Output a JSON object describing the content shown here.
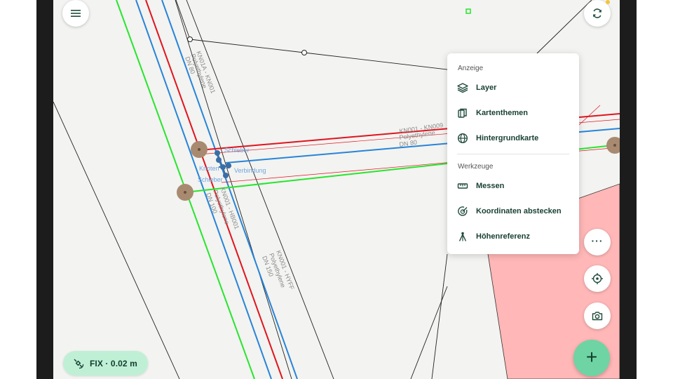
{
  "map": {
    "labels": {
      "kn01a_kn001": "KN01A - KN001",
      "kn01a_material": "Polyethylene",
      "kn01a_dn": "DN 80",
      "kn001_kn009": "KN001 - KN009",
      "kn001_material": "Polyethylene",
      "kn001_dn": "DN 80",
      "kn001_hb001": "KN001 - HB001",
      "kn001_hb001_material": "Polyethylene",
      "kn001_hb001_dn": "DN 100",
      "kn001_hyff": "KN001 - HYFF",
      "kn001_hyff_material": "Polyethylene",
      "kn001_hyff_dn": "DN 150",
      "knoten": "Knoten",
      "schieber_top": "Schieber",
      "verbindung": "Verbindung",
      "schieber_bottom": "Schieber"
    },
    "colors": {
      "background": "#f3f3f1",
      "line_red": "#e0141e",
      "line_blue": "#2784d8",
      "line_green": "#27e52d",
      "zone_fill": "#ffb7b7"
    }
  },
  "buttons": {
    "menu_icon": "hamburger-icon",
    "sync_icon": "sync-icon",
    "more_label": "···",
    "locate_icon": "locate-icon",
    "camera_icon": "camera-icon",
    "add_label": "+"
  },
  "gps": {
    "status": "FIX · 0.02 m"
  },
  "menu": {
    "section_display": "Anzeige",
    "items_display": [
      {
        "label": "Layer",
        "icon": "layers-icon"
      },
      {
        "label": "Kartenthemen",
        "icon": "map-themes-icon"
      },
      {
        "label": "Hintergrundkarte",
        "icon": "globe-icon"
      }
    ],
    "section_tools": "Werkzeuge",
    "items_tools": [
      {
        "label": "Messen",
        "icon": "ruler-icon"
      },
      {
        "label": "Koordinaten abstecken",
        "icon": "target-icon"
      },
      {
        "label": "Höhenreferenz",
        "icon": "tripod-icon"
      }
    ]
  }
}
